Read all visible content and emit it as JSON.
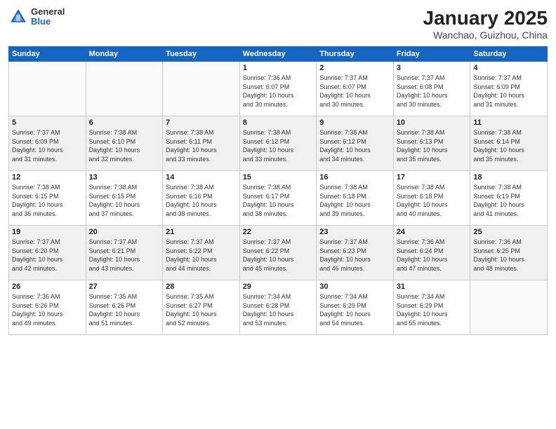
{
  "logo": {
    "general": "General",
    "blue": "Blue"
  },
  "title": "January 2025",
  "subtitle": "Wanchao, Guizhou, China",
  "days_of_week": [
    "Sunday",
    "Monday",
    "Tuesday",
    "Wednesday",
    "Thursday",
    "Friday",
    "Saturday"
  ],
  "weeks": [
    [
      {
        "day": "",
        "info": ""
      },
      {
        "day": "",
        "info": ""
      },
      {
        "day": "",
        "info": ""
      },
      {
        "day": "1",
        "info": "Sunrise: 7:36 AM\nSunset: 6:07 PM\nDaylight: 10 hours\nand 30 minutes."
      },
      {
        "day": "2",
        "info": "Sunrise: 7:37 AM\nSunset: 6:07 PM\nDaylight: 10 hours\nand 30 minutes."
      },
      {
        "day": "3",
        "info": "Sunrise: 7:37 AM\nSunset: 6:08 PM\nDaylight: 10 hours\nand 30 minutes."
      },
      {
        "day": "4",
        "info": "Sunrise: 7:37 AM\nSunset: 6:09 PM\nDaylight: 10 hours\nand 31 minutes."
      }
    ],
    [
      {
        "day": "5",
        "info": "Sunrise: 7:37 AM\nSunset: 6:09 PM\nDaylight: 10 hours\nand 31 minutes."
      },
      {
        "day": "6",
        "info": "Sunrise: 7:38 AM\nSunset: 6:10 PM\nDaylight: 10 hours\nand 32 minutes."
      },
      {
        "day": "7",
        "info": "Sunrise: 7:38 AM\nSunset: 6:11 PM\nDaylight: 10 hours\nand 33 minutes."
      },
      {
        "day": "8",
        "info": "Sunrise: 7:38 AM\nSunset: 6:12 PM\nDaylight: 10 hours\nand 33 minutes."
      },
      {
        "day": "9",
        "info": "Sunrise: 7:38 AM\nSunset: 6:12 PM\nDaylight: 10 hours\nand 34 minutes."
      },
      {
        "day": "10",
        "info": "Sunrise: 7:38 AM\nSunset: 6:13 PM\nDaylight: 10 hours\nand 35 minutes."
      },
      {
        "day": "11",
        "info": "Sunrise: 7:38 AM\nSunset: 6:14 PM\nDaylight: 10 hours\nand 35 minutes."
      }
    ],
    [
      {
        "day": "12",
        "info": "Sunrise: 7:38 AM\nSunset: 6:15 PM\nDaylight: 10 hours\nand 36 minutes."
      },
      {
        "day": "13",
        "info": "Sunrise: 7:38 AM\nSunset: 6:15 PM\nDaylight: 10 hours\nand 37 minutes."
      },
      {
        "day": "14",
        "info": "Sunrise: 7:38 AM\nSunset: 6:16 PM\nDaylight: 10 hours\nand 38 minutes."
      },
      {
        "day": "15",
        "info": "Sunrise: 7:38 AM\nSunset: 6:17 PM\nDaylight: 10 hours\nand 38 minutes."
      },
      {
        "day": "16",
        "info": "Sunrise: 7:38 AM\nSunset: 6:18 PM\nDaylight: 10 hours\nand 39 minutes."
      },
      {
        "day": "17",
        "info": "Sunrise: 7:38 AM\nSunset: 6:18 PM\nDaylight: 10 hours\nand 40 minutes."
      },
      {
        "day": "18",
        "info": "Sunrise: 7:38 AM\nSunset: 6:19 PM\nDaylight: 10 hours\nand 41 minutes."
      }
    ],
    [
      {
        "day": "19",
        "info": "Sunrise: 7:37 AM\nSunset: 6:20 PM\nDaylight: 10 hours\nand 42 minutes."
      },
      {
        "day": "20",
        "info": "Sunrise: 7:37 AM\nSunset: 6:21 PM\nDaylight: 10 hours\nand 43 minutes."
      },
      {
        "day": "21",
        "info": "Sunrise: 7:37 AM\nSunset: 6:22 PM\nDaylight: 10 hours\nand 44 minutes."
      },
      {
        "day": "22",
        "info": "Sunrise: 7:37 AM\nSunset: 6:22 PM\nDaylight: 10 hours\nand 45 minutes."
      },
      {
        "day": "23",
        "info": "Sunrise: 7:37 AM\nSunset: 6:23 PM\nDaylight: 10 hours\nand 46 minutes."
      },
      {
        "day": "24",
        "info": "Sunrise: 7:36 AM\nSunset: 6:24 PM\nDaylight: 10 hours\nand 47 minutes."
      },
      {
        "day": "25",
        "info": "Sunrise: 7:36 AM\nSunset: 6:25 PM\nDaylight: 10 hours\nand 48 minutes."
      }
    ],
    [
      {
        "day": "26",
        "info": "Sunrise: 7:36 AM\nSunset: 6:26 PM\nDaylight: 10 hours\nand 49 minutes."
      },
      {
        "day": "27",
        "info": "Sunrise: 7:35 AM\nSunset: 6:26 PM\nDaylight: 10 hours\nand 51 minutes."
      },
      {
        "day": "28",
        "info": "Sunrise: 7:35 AM\nSunset: 6:27 PM\nDaylight: 10 hours\nand 52 minutes."
      },
      {
        "day": "29",
        "info": "Sunrise: 7:34 AM\nSunset: 6:28 PM\nDaylight: 10 hours\nand 53 minutes."
      },
      {
        "day": "30",
        "info": "Sunrise: 7:34 AM\nSunset: 6:29 PM\nDaylight: 10 hours\nand 54 minutes."
      },
      {
        "day": "31",
        "info": "Sunrise: 7:34 AM\nSunset: 6:29 PM\nDaylight: 10 hours\nand 55 minutes."
      },
      {
        "day": "",
        "info": ""
      }
    ]
  ]
}
